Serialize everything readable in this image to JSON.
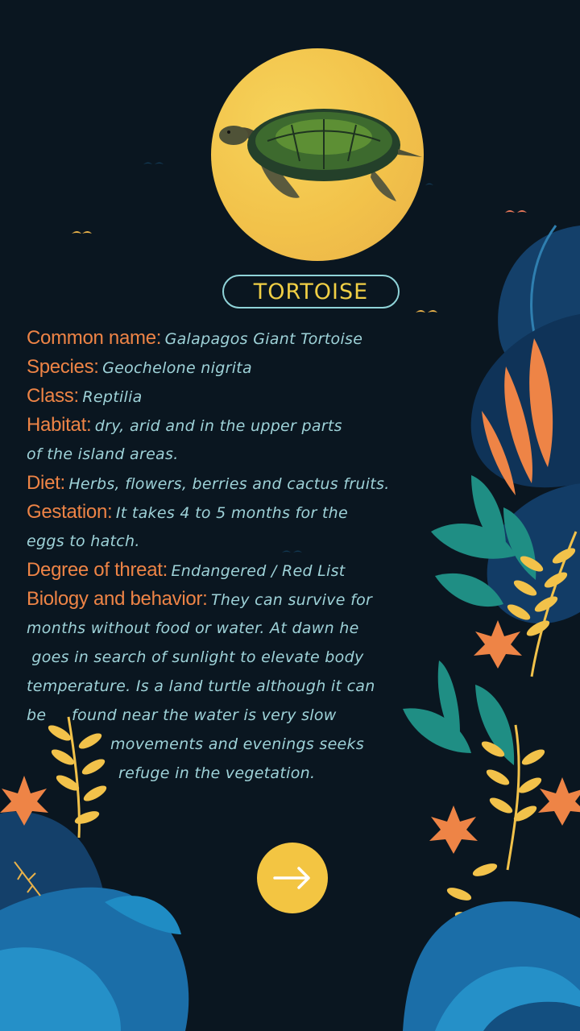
{
  "title": "TORTOISE",
  "info": [
    {
      "label": "Common name:",
      "value": "Galapagos Giant Tortoise"
    },
    {
      "label": "Species:",
      "value": "Geochelone nigrita"
    },
    {
      "label": "Class:",
      "value": "Reptilia"
    },
    {
      "label": "Habitat:",
      "value": "dry, arid and in the upper parts"
    },
    {
      "label": "",
      "value": "of the island areas."
    },
    {
      "label": "Diet:",
      "value": "Herbs, flowers, berries and cactus fruits."
    },
    {
      "label": "Gestation:",
      "value": "It takes 4 to 5 months for the"
    },
    {
      "label": "",
      "value": "eggs to hatch."
    },
    {
      "label": "Degree of threat:",
      "value": " Endangered / Red List"
    },
    {
      "label": "Biology and behavior:",
      "value": "They can survive for"
    },
    {
      "label": "",
      "value": "months without food or water. At dawn he"
    },
    {
      "label": "",
      "value": " goes in search of sunlight to elevate body"
    },
    {
      "label": "",
      "value": "temperature. Is a land turtle although it can"
    },
    {
      "label": "",
      "value": "be     found near the water is very slow"
    },
    {
      "label": "",
      "value": "movements and evenings seeks"
    },
    {
      "label": "",
      "value": "refuge in the vegetation."
    }
  ],
  "icons": {
    "hero": "sea-turtle-illustration",
    "next": "arrow-right-icon"
  },
  "colors": {
    "background": "#0a1620",
    "sun": "#f2c24a",
    "label": "#ee8446",
    "value": "#9ed2d8",
    "title": "#f0cf45",
    "button": "#f3c542"
  }
}
